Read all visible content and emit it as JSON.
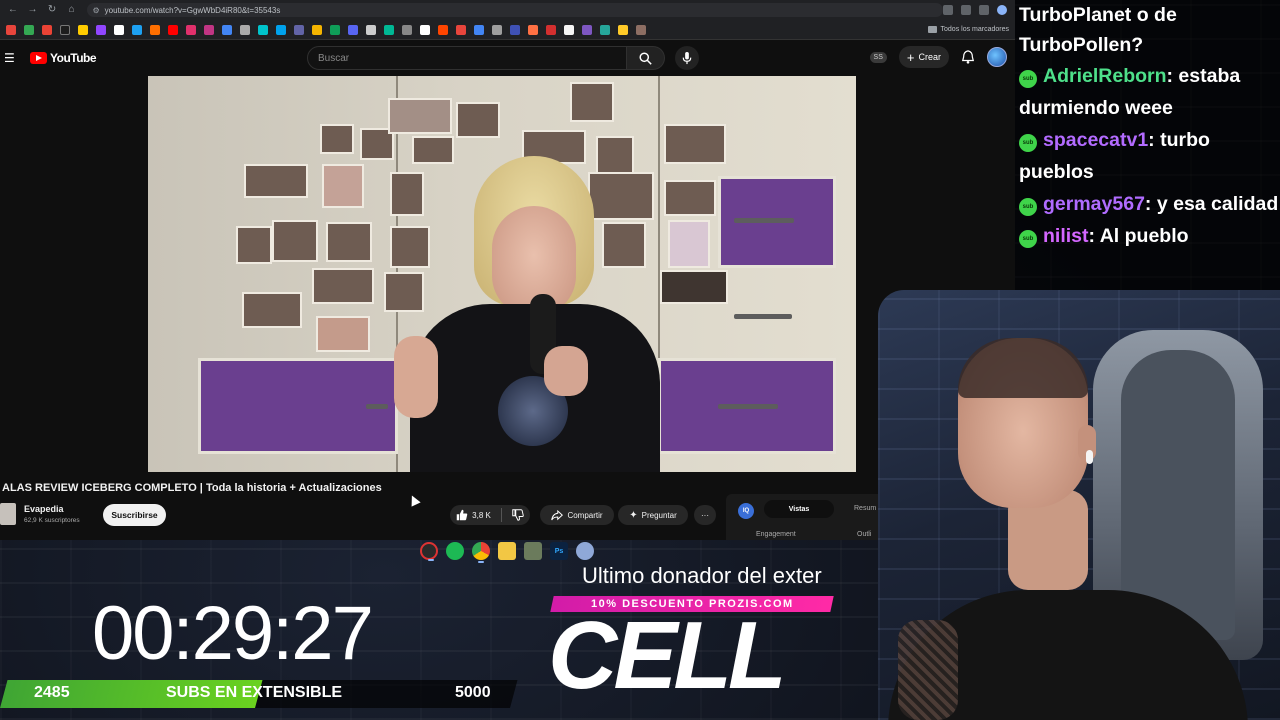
{
  "browser": {
    "url": "youtube.com/watch?v=GgwWbD4iR80&t=35543s",
    "bookmarks_folder": "Todos los marcadores"
  },
  "youtube": {
    "logo_text": "YouTube",
    "search_placeholder": "Buscar",
    "ss_badge": "SS",
    "create_label": "Crear"
  },
  "video": {
    "title": "ALAS REVIEW ICEBERG COMPLETO | Toda la historia + Actualizaciones",
    "channel_name": "Evapedia",
    "subscribers": "62,9 K suscriptores",
    "subscribe_label": "Suscribirse",
    "likes": "3,8 K",
    "share_label": "Compartir",
    "ask_label": "Preguntar",
    "more_label": "···"
  },
  "side_panel": {
    "icon_text": "IQ",
    "tab_active": "Vistas",
    "tab_other": "Resum",
    "label_left": "Engagement",
    "label_right": "Outli"
  },
  "chat": {
    "top_text": "TurboPlanet o de TurboPollen?",
    "badge_text": "sub",
    "messages": [
      {
        "user": "AdrielReborn",
        "color": "#4ee08a",
        "text": ": estaba durmiendo weee"
      },
      {
        "user": "spacecatv1",
        "color": "#b36bff",
        "text": ": turbo pueblos"
      },
      {
        "user": "germay567",
        "color": "#b06cff",
        "text": ": y esa calidad"
      },
      {
        "user": "nilist",
        "color": "#d467ff",
        "text": ": Al pueblo"
      }
    ]
  },
  "overlay": {
    "timer": "00:29:27",
    "subs_current": "2485",
    "subs_label": "SUBS EN EXTENSIBLE",
    "subs_goal": "5000",
    "subs_fill_fraction": 0.5,
    "donation_title": "Ultimo donador del exter",
    "donation_promo": "10% DESCUENTO PROZIS.COM",
    "donation_name": "CELL"
  },
  "colors": {
    "youtube_red": "#ff0000",
    "progress_green": "#6ad21f",
    "promo_pink": "#ff2aa6",
    "chat_badge_green": "#3fd44a"
  }
}
